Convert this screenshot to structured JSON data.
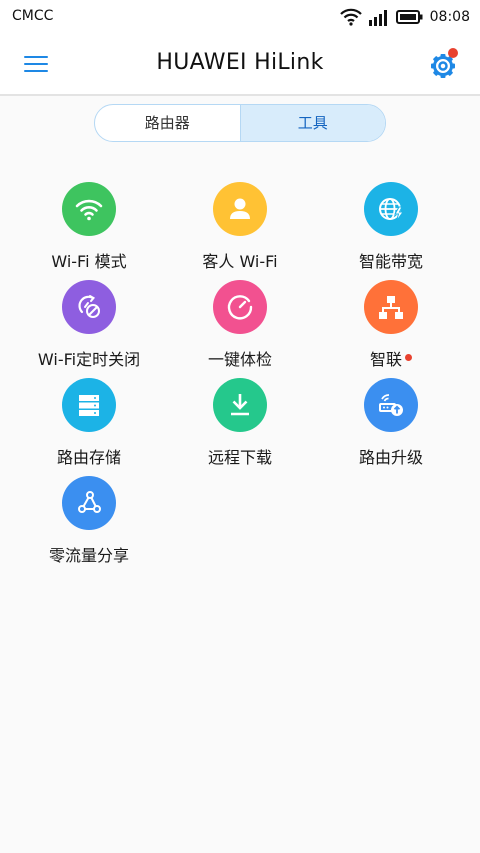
{
  "status_bar": {
    "carrier": "CMCC",
    "time": "08:08"
  },
  "header": {
    "title": "HUAWEI HiLink"
  },
  "tabs": [
    {
      "label": "路由器",
      "active": false
    },
    {
      "label": "工具",
      "active": true
    }
  ],
  "tools": [
    {
      "label": "Wi-Fi 模式",
      "color": "#3ec45f",
      "icon": "wifi-icon"
    },
    {
      "label": "客人 Wi-Fi",
      "color": "#ffc234",
      "icon": "guest-user-icon"
    },
    {
      "label": "智能带宽",
      "color": "#1cb3e6",
      "icon": "globe-bolt-icon"
    },
    {
      "label": "Wi-Fi定时关闭",
      "color": "#8e5ee0",
      "icon": "wifi-timer-off-icon"
    },
    {
      "label": "一键体检",
      "color": "#f25190",
      "icon": "speedometer-icon"
    },
    {
      "label": "智联",
      "color": "#ff7139",
      "icon": "network-tree-icon",
      "badge": true
    },
    {
      "label": "路由存储",
      "color": "#1cb3e6",
      "icon": "storage-icon"
    },
    {
      "label": "远程下载",
      "color": "#25c88c",
      "icon": "download-icon"
    },
    {
      "label": "路由升级",
      "color": "#3b8ff0",
      "icon": "router-upgrade-icon"
    },
    {
      "label": "零流量分享",
      "color": "#3b8ff0",
      "icon": "share-icon"
    }
  ],
  "colors": {
    "accent": "#1e88e5",
    "badge": "#e8422f",
    "tab_active_bg": "#d8ecfb"
  }
}
